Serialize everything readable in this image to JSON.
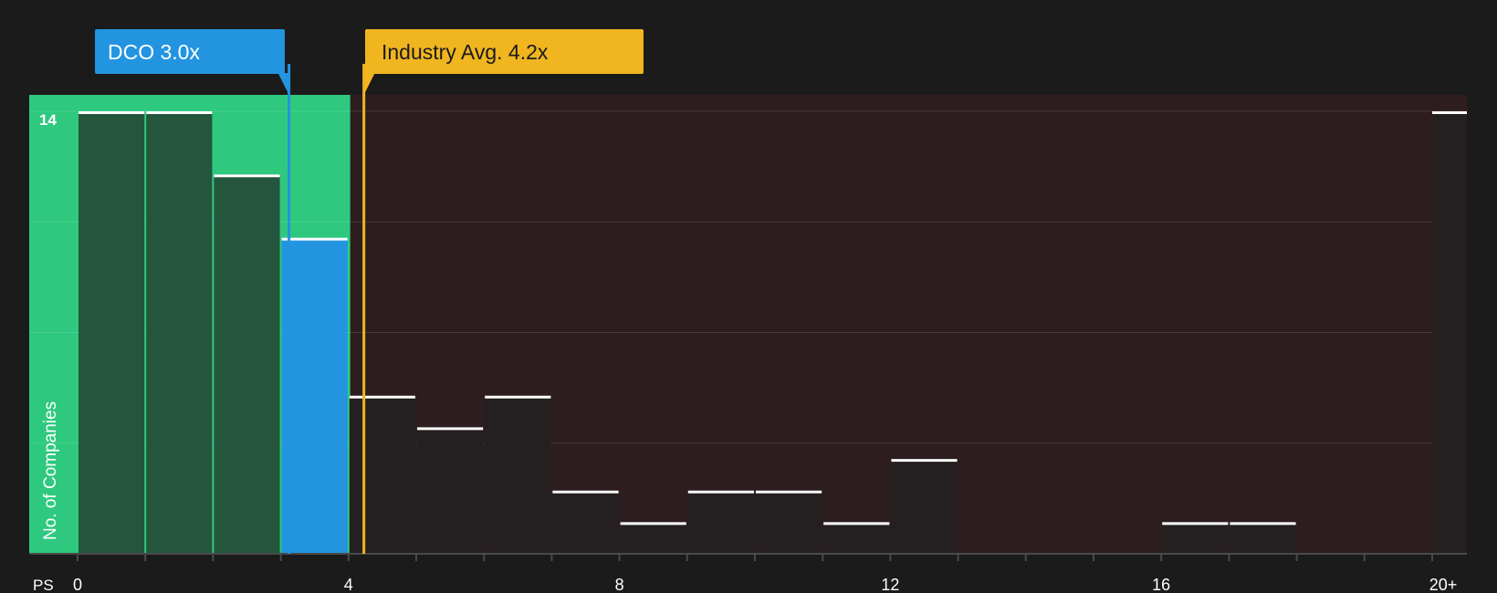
{
  "chart_data": {
    "type": "bar",
    "xlabel": "PS",
    "ylabel": "No. of Companies",
    "x_ticks": [
      "0",
      "4",
      "8",
      "12",
      "16",
      "20+"
    ],
    "y_tick_label": "14",
    "xlim": [
      0,
      21.5
    ],
    "ylim": [
      0,
      14.5
    ],
    "bins": [
      {
        "x0": 0,
        "x1": 1,
        "value": 14
      },
      {
        "x0": 1,
        "x1": 2,
        "value": 14
      },
      {
        "x0": 2,
        "x1": 3,
        "value": 12
      },
      {
        "x0": 3,
        "x1": 4,
        "value": 10,
        "highlight": true
      },
      {
        "x0": 4,
        "x1": 5,
        "value": 5
      },
      {
        "x0": 5,
        "x1": 6,
        "value": 4
      },
      {
        "x0": 6,
        "x1": 7,
        "value": 5
      },
      {
        "x0": 7,
        "x1": 8,
        "value": 2
      },
      {
        "x0": 8,
        "x1": 9,
        "value": 1
      },
      {
        "x0": 9,
        "x1": 10,
        "value": 2
      },
      {
        "x0": 10,
        "x1": 11,
        "value": 2
      },
      {
        "x0": 11,
        "x1": 12,
        "value": 1
      },
      {
        "x0": 12,
        "x1": 13,
        "value": 3
      },
      {
        "x0": 13,
        "x1": 14,
        "value": 0
      },
      {
        "x0": 14,
        "x1": 15,
        "value": 0
      },
      {
        "x0": 15,
        "x1": 16,
        "value": 0
      },
      {
        "x0": 16,
        "x1": 17,
        "value": 1
      },
      {
        "x0": 17,
        "x1": 18,
        "value": 1
      },
      {
        "x0": 18,
        "x1": 19,
        "value": 0
      },
      {
        "x0": 19,
        "x1": 20,
        "value": 0
      },
      {
        "x0": 20,
        "x1": 21.5,
        "value": 14
      }
    ],
    "company": {
      "label": "DCO 3.0x",
      "value": 3.0
    },
    "industry": {
      "label": "Industry Avg. 4.2x",
      "value": 4.2
    },
    "grid": true,
    "colors": {
      "background": "#1b1b1b",
      "fair_zone": "#2ec97e",
      "overvalued_zone": "#2d1d1e",
      "bar": "#244b37",
      "bar_dark": "#241f20",
      "highlight_bar": "#2394e0",
      "company_marker": "#2394e0",
      "industry_marker": "#f0b51f",
      "bar_cap": "#ffffff",
      "text": "#ffffff"
    }
  }
}
